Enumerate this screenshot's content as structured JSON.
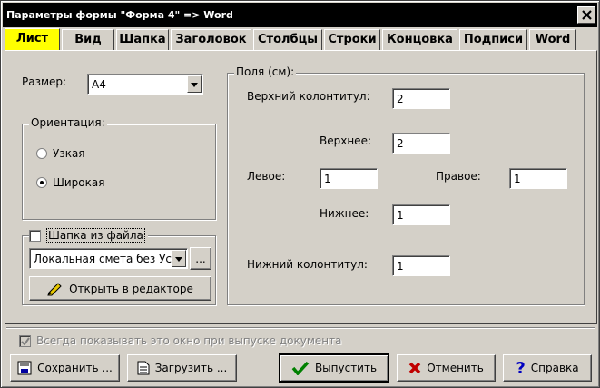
{
  "window": {
    "title": "Параметры формы \"Форма 4\" => Word"
  },
  "tabs": [
    {
      "label": "Лист",
      "active": true
    },
    {
      "label": "Вид",
      "active": false
    },
    {
      "label": "Шапка",
      "active": false
    },
    {
      "label": "Заголовок",
      "active": false
    },
    {
      "label": "Столбцы",
      "active": false
    },
    {
      "label": "Строки",
      "active": false
    },
    {
      "label": "Концовка",
      "active": false
    },
    {
      "label": "Подписи",
      "active": false
    },
    {
      "label": "Word",
      "active": false
    }
  ],
  "sheet": {
    "size_label": "Размер:",
    "size_value": "A4",
    "orientation": {
      "title": "Ориентация:",
      "options": [
        {
          "label": "Узкая",
          "selected": false
        },
        {
          "label": "Широкая",
          "selected": true
        }
      ]
    },
    "header_from_file": {
      "label": "Шапка из файла",
      "checked": false,
      "file_value": "Локальная смета без Ус",
      "browse_label": "...",
      "open_editor_label": "Открыть в редакторе"
    }
  },
  "margins": {
    "title": "Поля (см):",
    "header_label": "Верхний колонтитул:",
    "header_value": "2",
    "top_label": "Верхнее:",
    "top_value": "2",
    "left_label": "Левое:",
    "left_value": "1",
    "right_label": "Правое:",
    "right_value": "1",
    "bottom_label": "Нижнее:",
    "bottom_value": "1",
    "footer_label": "Нижний колонтитул:",
    "footer_value": "1"
  },
  "always_show": {
    "label": "Всегда показывать это окно при выпуске документа",
    "checked": true,
    "disabled": true
  },
  "buttons": {
    "save": "Сохранить ...",
    "load": "Загрузить ...",
    "publish": "Выпустить",
    "cancel": "Отменить",
    "help": "Справка"
  },
  "colors": {
    "active_tab": "#ffff00",
    "titlebar": "#000000",
    "check_green": "#008000",
    "cancel_red": "#c00000",
    "help_blue": "#0000c0"
  },
  "icons": {
    "close": "close-icon",
    "save": "save-icon",
    "load": "load-icon",
    "publish": "checkmark-icon",
    "cancel": "cross-icon",
    "help": "question-icon",
    "open_editor": "pencil-icon"
  }
}
